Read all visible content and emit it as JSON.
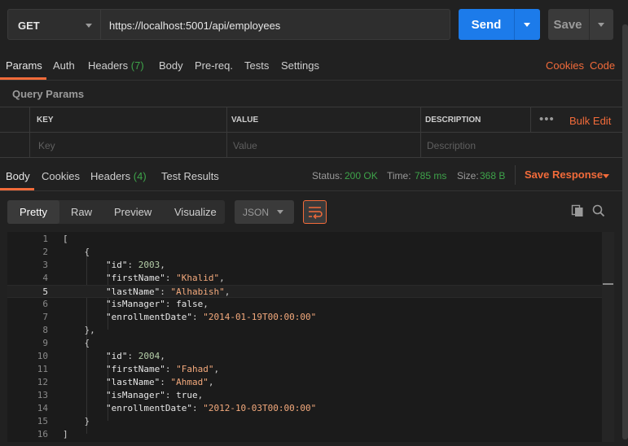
{
  "request": {
    "method": "GET",
    "url": "https://localhost:5001/api/employees",
    "send_label": "Send",
    "save_label": "Save"
  },
  "request_tabs": {
    "params": "Params",
    "auth": "Auth",
    "headers": "Headers",
    "headers_count": "(7)",
    "body": "Body",
    "prereq": "Pre-req.",
    "tests": "Tests",
    "settings": "Settings",
    "cookies": "Cookies",
    "code": "Code"
  },
  "query_params": {
    "title": "Query Params",
    "headers": {
      "key": "KEY",
      "value": "VALUE",
      "description": "DESCRIPTION"
    },
    "placeholders": {
      "key": "Key",
      "value": "Value",
      "description": "Description"
    },
    "more": "•••",
    "bulk_edit": "Bulk Edit"
  },
  "response_tabs": {
    "body": "Body",
    "cookies": "Cookies",
    "headers": "Headers",
    "headers_count": "(4)",
    "test_results": "Test Results",
    "status_label": "Status:",
    "status_value": "200 OK",
    "time_label": "Time:",
    "time_value": "785 ms",
    "size_label": "Size:",
    "size_value": "368 B",
    "save_response": "Save Response"
  },
  "view": {
    "pretty": "Pretty",
    "raw": "Raw",
    "preview": "Preview",
    "visualize": "Visualize",
    "format": "JSON"
  },
  "code_lines": [
    {
      "n": "1",
      "text": "["
    },
    {
      "n": "2",
      "text": "    {"
    },
    {
      "n": "3",
      "text": "        \"id\": 2003,"
    },
    {
      "n": "4",
      "text": "        \"firstName\": \"Khalid\","
    },
    {
      "n": "5",
      "text": "        \"lastName\": \"Alhabish\","
    },
    {
      "n": "6",
      "text": "        \"isManager\": false,"
    },
    {
      "n": "7",
      "text": "        \"enrollmentDate\": \"2014-01-19T00:00:00\""
    },
    {
      "n": "8",
      "text": "    },"
    },
    {
      "n": "9",
      "text": "    {"
    },
    {
      "n": "10",
      "text": "        \"id\": 2004,"
    },
    {
      "n": "11",
      "text": "        \"firstName\": \"Fahad\","
    },
    {
      "n": "12",
      "text": "        \"lastName\": \"Ahmad\","
    },
    {
      "n": "13",
      "text": "        \"isManager\": true,"
    },
    {
      "n": "14",
      "text": "        \"enrollmentDate\": \"2012-10-03T00:00:00\""
    },
    {
      "n": "15",
      "text": "    }"
    },
    {
      "n": "16",
      "text": "]"
    }
  ],
  "current_line": 5,
  "colors": {
    "accent": "#f26b3a",
    "send": "#1c7bea",
    "success": "#3ea34a",
    "string": "#f3a97c",
    "number": "#b5cea8"
  },
  "icons": [
    "chevron-down-icon",
    "copy-icon",
    "search-icon",
    "wrap-lines-icon",
    "more-icon"
  ]
}
